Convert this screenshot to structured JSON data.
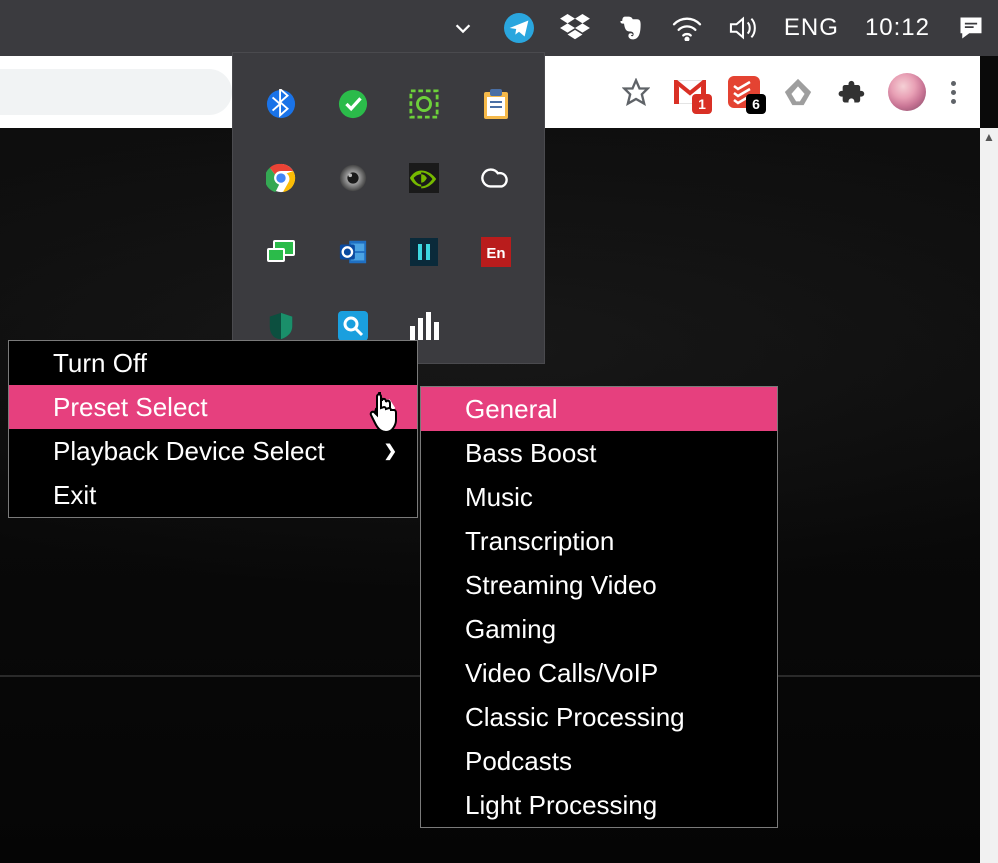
{
  "taskbar": {
    "language": "ENG",
    "clock": "10:12"
  },
  "browser": {
    "badges": {
      "gmail": "1",
      "todoist": "6"
    }
  },
  "tray_panel": {
    "icons": [
      "bluetooth-icon",
      "sync-ok-icon",
      "greenshot-icon",
      "clipboard-icon",
      "chrome-icon",
      "speaker-icon",
      "nvidia-icon",
      "creative-cloud-icon",
      "display-icon",
      "outlook-icon",
      "pause-app-icon",
      "en-app-icon",
      "kaspersky-icon",
      "search-app-icon",
      "equalizer-icon",
      ""
    ]
  },
  "context_menu": {
    "items": [
      {
        "label": "Turn Off",
        "submenu": false,
        "hover": false
      },
      {
        "label": "Preset Select",
        "submenu": true,
        "hover": true
      },
      {
        "label": "Playback Device Select",
        "submenu": true,
        "hover": false
      },
      {
        "label": "Exit",
        "submenu": false,
        "hover": false
      }
    ]
  },
  "preset_submenu": {
    "items": [
      {
        "label": "General",
        "hover": true
      },
      {
        "label": "Bass Boost",
        "hover": false
      },
      {
        "label": "Music",
        "hover": false
      },
      {
        "label": "Transcription",
        "hover": false
      },
      {
        "label": "Streaming Video",
        "hover": false
      },
      {
        "label": "Gaming",
        "hover": false
      },
      {
        "label": "Video Calls/VoIP",
        "hover": false
      },
      {
        "label": "Classic Processing",
        "hover": false
      },
      {
        "label": "Podcasts",
        "hover": false
      },
      {
        "label": "Light Processing",
        "hover": false
      }
    ]
  }
}
